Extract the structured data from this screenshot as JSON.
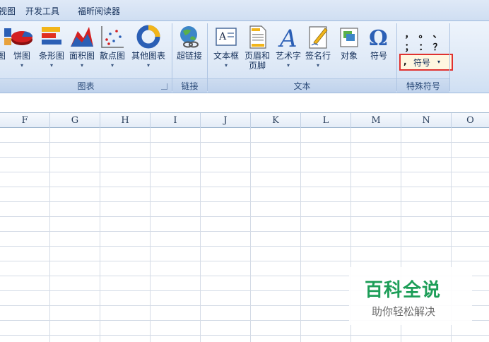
{
  "menu": {
    "tabs": [
      "视图",
      "开发工具",
      "福昕阅读器"
    ]
  },
  "ribbon": {
    "charts": {
      "buttons": [
        {
          "label": "图",
          "icon": "chart-icon"
        },
        {
          "label": "饼图",
          "icon": "pie-chart-icon"
        },
        {
          "label": "条形图",
          "icon": "bar-chart-icon"
        },
        {
          "label": "面积图",
          "icon": "area-chart-icon"
        },
        {
          "label": "散点图",
          "icon": "scatter-chart-icon"
        },
        {
          "label": "其他图表",
          "icon": "donut-chart-icon"
        }
      ],
      "group_label": "图表"
    },
    "links": {
      "buttons": [
        {
          "label": "超链接",
          "icon": "hyperlink-icon"
        }
      ],
      "group_label": "链接"
    },
    "text": {
      "buttons": [
        {
          "label": "文本框",
          "icon": "textbox-icon"
        },
        {
          "label": "页眉和",
          "label2": "页脚",
          "icon": "header-footer-icon"
        },
        {
          "label": "艺术字",
          "icon": "wordart-icon"
        },
        {
          "label": "签名行",
          "icon": "signature-line-icon"
        },
        {
          "label": "对象",
          "icon": "object-icon"
        },
        {
          "label": "符号",
          "icon": "omega-icon"
        }
      ],
      "group_label": "文本"
    },
    "special_symbols": {
      "symbols": [
        "，",
        "。",
        "、",
        "；",
        "：",
        "？"
      ],
      "dropdown_label": "符号",
      "group_label": "特殊符号"
    }
  },
  "sheet": {
    "columns": [
      "F",
      "G",
      "H",
      "I",
      "J",
      "K",
      "L",
      "M",
      "N",
      "O"
    ]
  },
  "watermark": {
    "title": "百科全说",
    "subtitle": "助你轻松解决"
  },
  "colors": {
    "highlight": "#e0312f",
    "watermark_green": "#1d9e58"
  }
}
